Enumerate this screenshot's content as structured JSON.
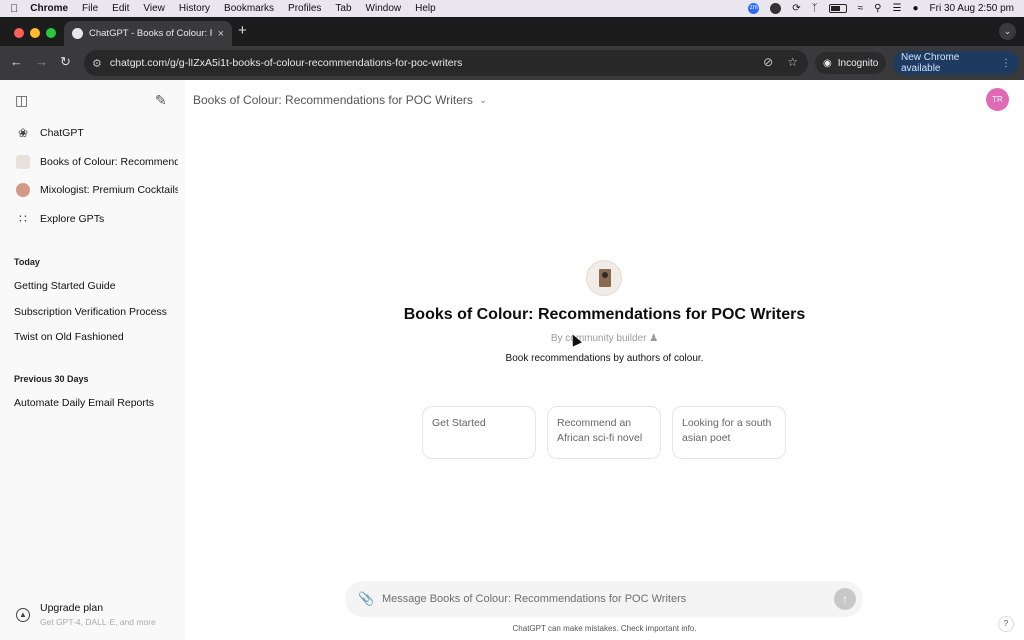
{
  "menubar": {
    "app": "Chrome",
    "items": [
      "File",
      "Edit",
      "View",
      "History",
      "Bookmarks",
      "Profiles",
      "Tab",
      "Window",
      "Help"
    ],
    "datetime": "Fri 30 Aug  2:50 pm",
    "zoom_badge": "zm"
  },
  "browser": {
    "tab_title": "ChatGPT - Books of Colour: R",
    "new_tab": "+",
    "url": "chatgpt.com/g/g-lIZxA5i1t-books-of-colour-recommendations-for-poc-writers",
    "incognito_label": "Incognito",
    "update_label": "New Chrome available"
  },
  "sidebar": {
    "nav": [
      {
        "label": "ChatGPT",
        "icon": "openai-icon"
      },
      {
        "label": "Books of Colour: Recommendations for POC Writers",
        "icon": "books-of-colour-avatar"
      },
      {
        "label": "Mixologist: Premium Cocktails",
        "icon": "mixologist-avatar"
      },
      {
        "label": "Explore GPTs",
        "icon": "grid-icon"
      }
    ],
    "today_label": "Today",
    "today": [
      "Getting Started Guide",
      "Subscription Verification Process",
      "Twist on Old Fashioned"
    ],
    "prev_label": "Previous 30 Days",
    "previous": [
      "Automate Daily Email Reports"
    ],
    "upgrade_title": "Upgrade plan",
    "upgrade_sub": "Get GPT-4, DALL·E, and more"
  },
  "main": {
    "header_title": "Books of Colour: Recommendations for POC Writers",
    "user_initials": "TR",
    "title": "Books of Colour: Recommendations for POC Writers",
    "byline": "By community builder",
    "description": "Book recommendations by authors of colour.",
    "starters": [
      "Get Started",
      "Recommend an African sci-fi novel",
      "Looking for a south asian poet"
    ],
    "composer_placeholder": "Message Books of Colour: Recommendations for POC Writers",
    "footnote": "ChatGPT can make mistakes. Check important info.",
    "help": "?"
  },
  "colors": {
    "avatar": "#e06ab4",
    "update_button": "#1e3a5f"
  }
}
